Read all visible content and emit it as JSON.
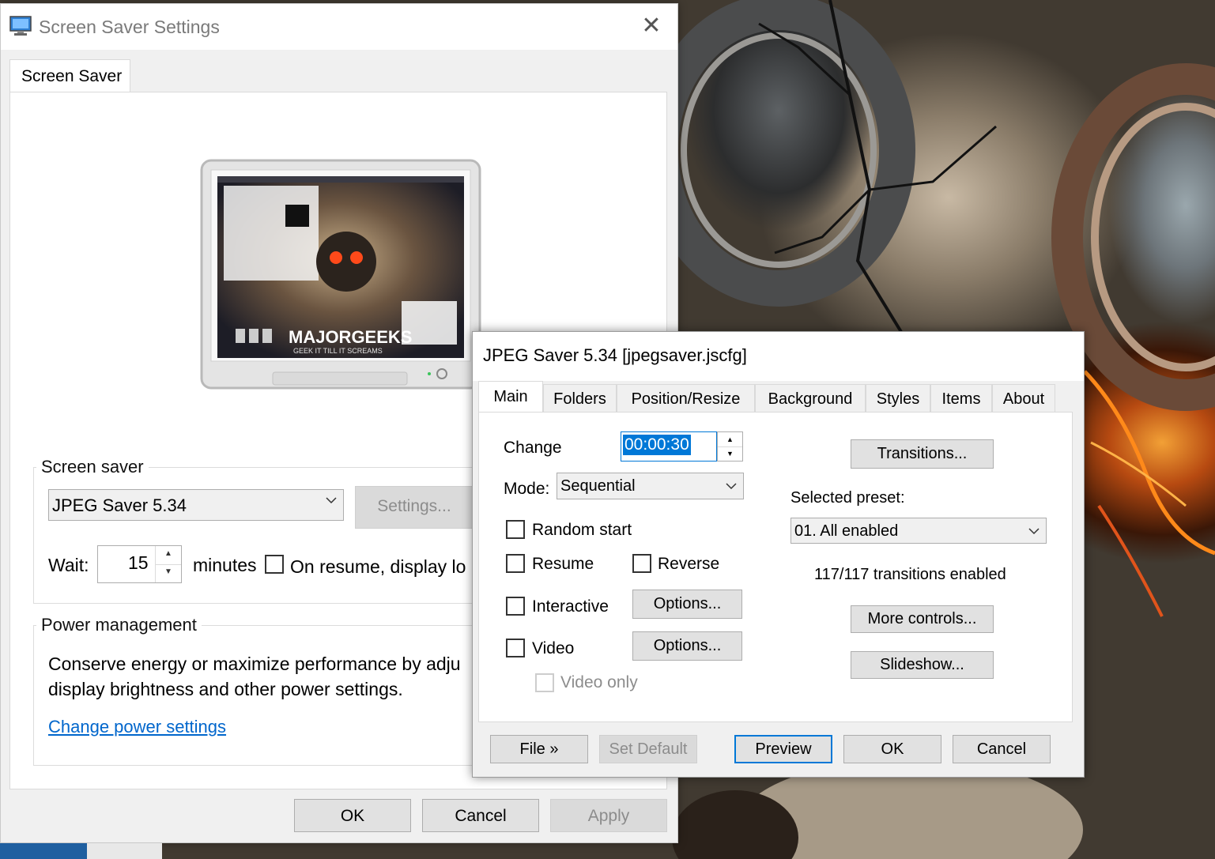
{
  "screensaver_window": {
    "title": "Screen Saver Settings",
    "tab": "Screen Saver",
    "preview_text": "MAJORGEEKS",
    "preview_subtext": "GEEK IT TILL IT SCREAMS",
    "screensaver_group": {
      "label": "Screen saver",
      "selected": "JPEG Saver 5.34",
      "settings_button": "Settings...",
      "wait_label": "Wait:",
      "wait_value": "15",
      "minutes_label": "minutes",
      "resume_label": "On resume, display lo"
    },
    "power_group": {
      "label": "Power management",
      "text_line1": "Conserve energy or maximize performance by adju",
      "text_line2": "display brightness and other power settings.",
      "link": "Change power settings"
    },
    "buttons": {
      "ok": "OK",
      "cancel": "Cancel",
      "apply": "Apply"
    }
  },
  "jpeg_dialog": {
    "title": "JPEG Saver 5.34 [jpegsaver.jscfg]",
    "tabs": [
      "Main",
      "Folders",
      "Position/Resize",
      "Background",
      "Styles",
      "Items",
      "About"
    ],
    "active_tab": "Main",
    "change_label": "Change",
    "change_value": "00:00:30",
    "mode_label": "Mode:",
    "mode_value": "Sequential",
    "checkboxes": {
      "random_start": "Random start",
      "resume": "Resume",
      "reverse": "Reverse",
      "interactive": "Interactive",
      "video": "Video",
      "video_only": "Video only"
    },
    "options_button": "Options...",
    "transitions_button": "Transitions...",
    "selected_preset_label": "Selected preset:",
    "selected_preset_value": "01. All enabled",
    "transitions_status": "117/117 transitions enabled",
    "more_controls_button": "More controls...",
    "slideshow_button": "Slideshow...",
    "footer": {
      "file": "File »",
      "set_default": "Set Default",
      "preview": "Preview",
      "ok": "OK",
      "cancel": "Cancel"
    }
  },
  "colors": {
    "accent": "#0078d7",
    "link": "#0066cc",
    "window_bg": "#f0f0f0",
    "disabled_text": "#8c8c8c"
  }
}
